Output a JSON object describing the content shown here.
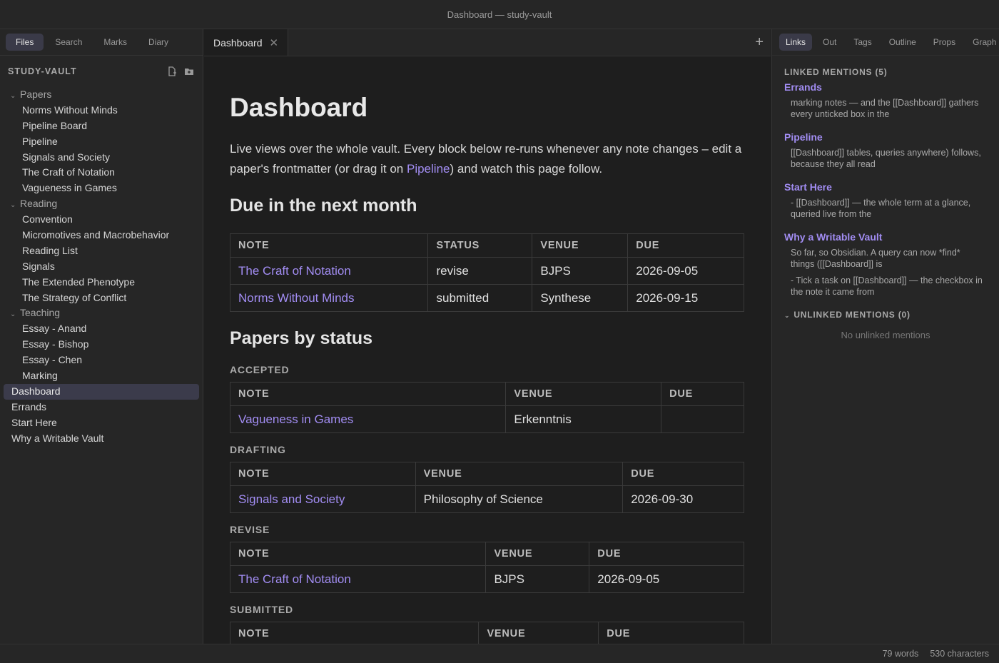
{
  "window": {
    "title": "Dashboard — study-vault"
  },
  "left_tabs": [
    "Files",
    "Search",
    "Marks",
    "Diary"
  ],
  "vault": {
    "name": "STUDY-VAULT"
  },
  "tree": [
    {
      "kind": "folder",
      "label": "Papers"
    },
    {
      "kind": "file",
      "label": "Norms Without Minds"
    },
    {
      "kind": "file",
      "label": "Pipeline Board"
    },
    {
      "kind": "file",
      "label": "Pipeline"
    },
    {
      "kind": "file",
      "label": "Signals and Society"
    },
    {
      "kind": "file",
      "label": "The Craft of Notation"
    },
    {
      "kind": "file",
      "label": "Vagueness in Games"
    },
    {
      "kind": "folder",
      "label": "Reading"
    },
    {
      "kind": "file",
      "label": "Convention"
    },
    {
      "kind": "file",
      "label": "Micromotives and Macrobehavior"
    },
    {
      "kind": "file",
      "label": "Reading List"
    },
    {
      "kind": "file",
      "label": "Signals"
    },
    {
      "kind": "file",
      "label": "The Extended Phenotype"
    },
    {
      "kind": "file",
      "label": "The Strategy of Conflict"
    },
    {
      "kind": "folder",
      "label": "Teaching"
    },
    {
      "kind": "file",
      "label": "Essay - Anand"
    },
    {
      "kind": "file",
      "label": "Essay - Bishop"
    },
    {
      "kind": "file",
      "label": "Essay - Chen"
    },
    {
      "kind": "file",
      "label": "Marking"
    },
    {
      "kind": "root",
      "label": "Dashboard",
      "selected": true
    },
    {
      "kind": "root",
      "label": "Errands"
    },
    {
      "kind": "root",
      "label": "Start Here"
    },
    {
      "kind": "root",
      "label": "Why a Writable Vault"
    }
  ],
  "editor": {
    "tab_label": "Dashboard",
    "title": "Dashboard",
    "intro_1": "Live views over the whole vault. Every block below re-runs whenever any note changes – edit a paper's frontmatter (or drag it on ",
    "intro_link": "Pipeline",
    "intro_2": ") and watch this page follow.",
    "due_heading": "Due in the next month",
    "due_table": {
      "headers": [
        "NOTE",
        "STATUS",
        "VENUE",
        "DUE"
      ],
      "rows": [
        [
          "The Craft of Notation",
          "revise",
          "BJPS",
          "2026-09-05"
        ],
        [
          "Norms Without Minds",
          "submitted",
          "Synthese",
          "2026-09-15"
        ]
      ]
    },
    "status_heading": "Papers by status",
    "groups": [
      {
        "label": "ACCEPTED",
        "headers": [
          "NOTE",
          "VENUE",
          "DUE"
        ],
        "rows": [
          [
            "Vagueness in Games",
            "Erkenntnis",
            ""
          ]
        ]
      },
      {
        "label": "DRAFTING",
        "headers": [
          "NOTE",
          "VENUE",
          "DUE"
        ],
        "rows": [
          [
            "Signals and Society",
            "Philosophy of Science",
            "2026-09-30"
          ]
        ]
      },
      {
        "label": "REVISE",
        "headers": [
          "NOTE",
          "VENUE",
          "DUE"
        ],
        "rows": [
          [
            "The Craft of Notation",
            "BJPS",
            "2026-09-05"
          ]
        ]
      },
      {
        "label": "SUBMITTED",
        "headers": [
          "NOTE",
          "VENUE",
          "DUE"
        ],
        "rows": []
      }
    ]
  },
  "right_tabs": [
    "Links",
    "Out",
    "Tags",
    "Outline",
    "Props",
    "Graph"
  ],
  "backlinks": {
    "linked_heading": "LINKED MENTIONS (5)",
    "mentions": [
      {
        "title": "Errands",
        "snippets": [
          "marking notes — and the [[Dashboard]] gathers every unticked box in the"
        ]
      },
      {
        "title": "Pipeline",
        "snippets": [
          "[[Dashboard]] tables, queries anywhere) follows, because they all read"
        ]
      },
      {
        "title": "Start Here",
        "snippets": [
          "- [[Dashboard]] — the whole term at a glance, queried live from the"
        ]
      },
      {
        "title": "Why a Writable Vault",
        "snippets": [
          "So far, so Obsidian. A query can now *find* things ([[Dashboard]] is",
          "- Tick a task on [[Dashboard]] — the checkbox in the note it came from"
        ]
      }
    ],
    "unlinked_heading": "UNLINKED MENTIONS (0)",
    "unlinked_empty": "No unlinked mentions"
  },
  "status": {
    "words": "79 words",
    "chars": "530 characters"
  }
}
